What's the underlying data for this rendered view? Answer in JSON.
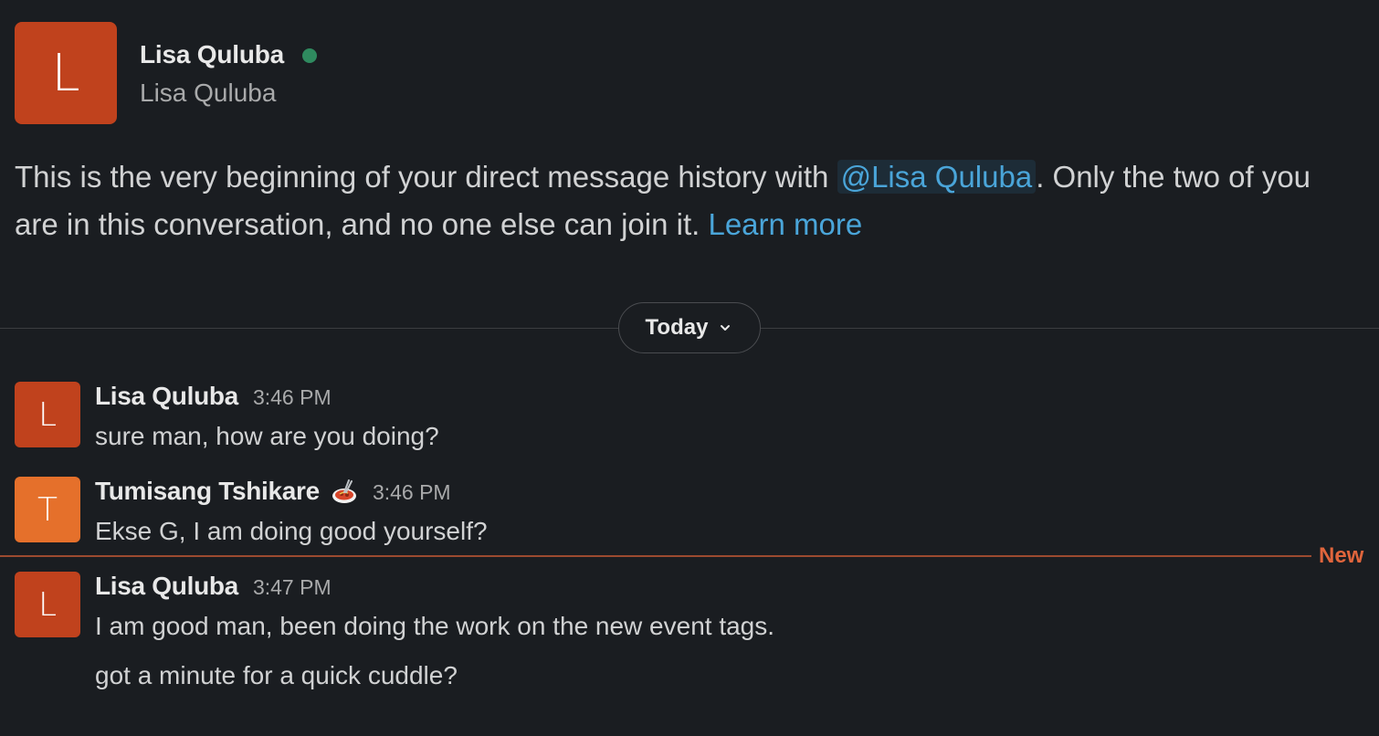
{
  "profile": {
    "avatar_initial": "L",
    "display_name": "Lisa Quluba",
    "full_name": "Lisa Quluba",
    "presence": "active",
    "avatar_color": "#c0421d"
  },
  "intro": {
    "text_before": "This is the very beginning of your direct message history with ",
    "mention": "@Lisa Quluba",
    "text_after": ". Only the two of you are in this conversation, and no one else can join it. ",
    "learn_more": "Learn more"
  },
  "date_divider": {
    "label": "Today",
    "icon": "chevron-down-icon"
  },
  "messages": [
    {
      "avatar_initial": "L",
      "avatar_color": "#c0421d",
      "author": "Lisa Quluba",
      "time": "3:46 PM",
      "lines": [
        "sure man, how are you doing?"
      ]
    },
    {
      "avatar_initial": "T",
      "avatar_color": "#e5702b",
      "author": "Tumisang Tshikare",
      "status_emoji": "spaghetti-icon",
      "time": "3:46 PM",
      "lines": [
        "Ekse G, I am doing good yourself?"
      ]
    },
    {
      "avatar_initial": "L",
      "avatar_color": "#c0421d",
      "author": "Lisa Quluba",
      "time": "3:47 PM",
      "lines": [
        "I am good man, been doing the work on the new event tags.",
        "got a minute for a quick cuddle?"
      ]
    }
  ],
  "new_divider": {
    "label": "New",
    "color": "#e0653c"
  }
}
